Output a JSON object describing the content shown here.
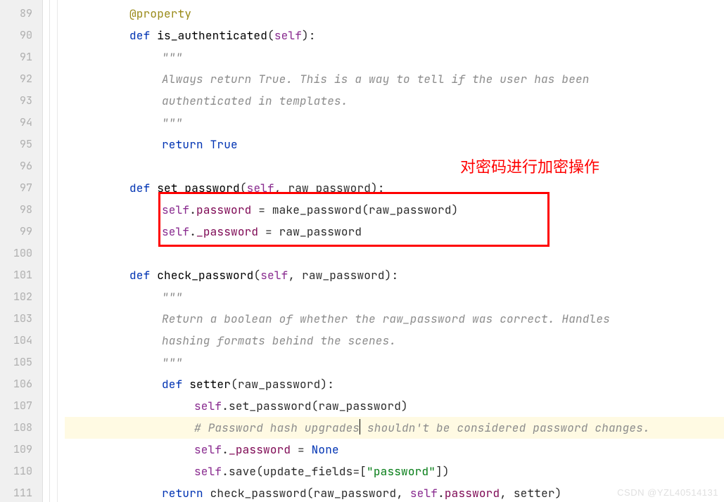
{
  "annotation": {
    "label": "对密码进行加密操作"
  },
  "watermark": "CSDN @YZL40514131",
  "gutter": {
    "start": 89,
    "end": 111
  },
  "tokens": {
    "decorator": "@property",
    "def": "def",
    "return": "return",
    "True": "True",
    "None": "None",
    "str_password": "\"password\"",
    "self": "self",
    "triplequote": "\"\"\"",
    "fn_is_authenticated": "is_authenticated",
    "fn_set_password": "set_password",
    "fn_check_password": "check_password",
    "fn_setter": "setter",
    "call_set_password": "set_password",
    "call_save": "save",
    "call_check_password": "check_password",
    "id_make_password": "make_password",
    "id_raw_password": "raw_password",
    "id_raw_password2": "raw_password",
    "id_password": "password",
    "id__password": "_password",
    "id_update_fields": "update_fields",
    "doc_l1": "Always return True. This is a way to tell if the user has been",
    "doc_l2": "authenticated in templates.",
    "doc_l3": "Return a boolean of whether the raw_password was correct. Handles",
    "doc_l4": "hashing formats behind the scenes.",
    "cmt_upgrade_a": "# Password hash upgrades",
    "cmt_upgrade_b": " shouldn't be considered password changes."
  }
}
